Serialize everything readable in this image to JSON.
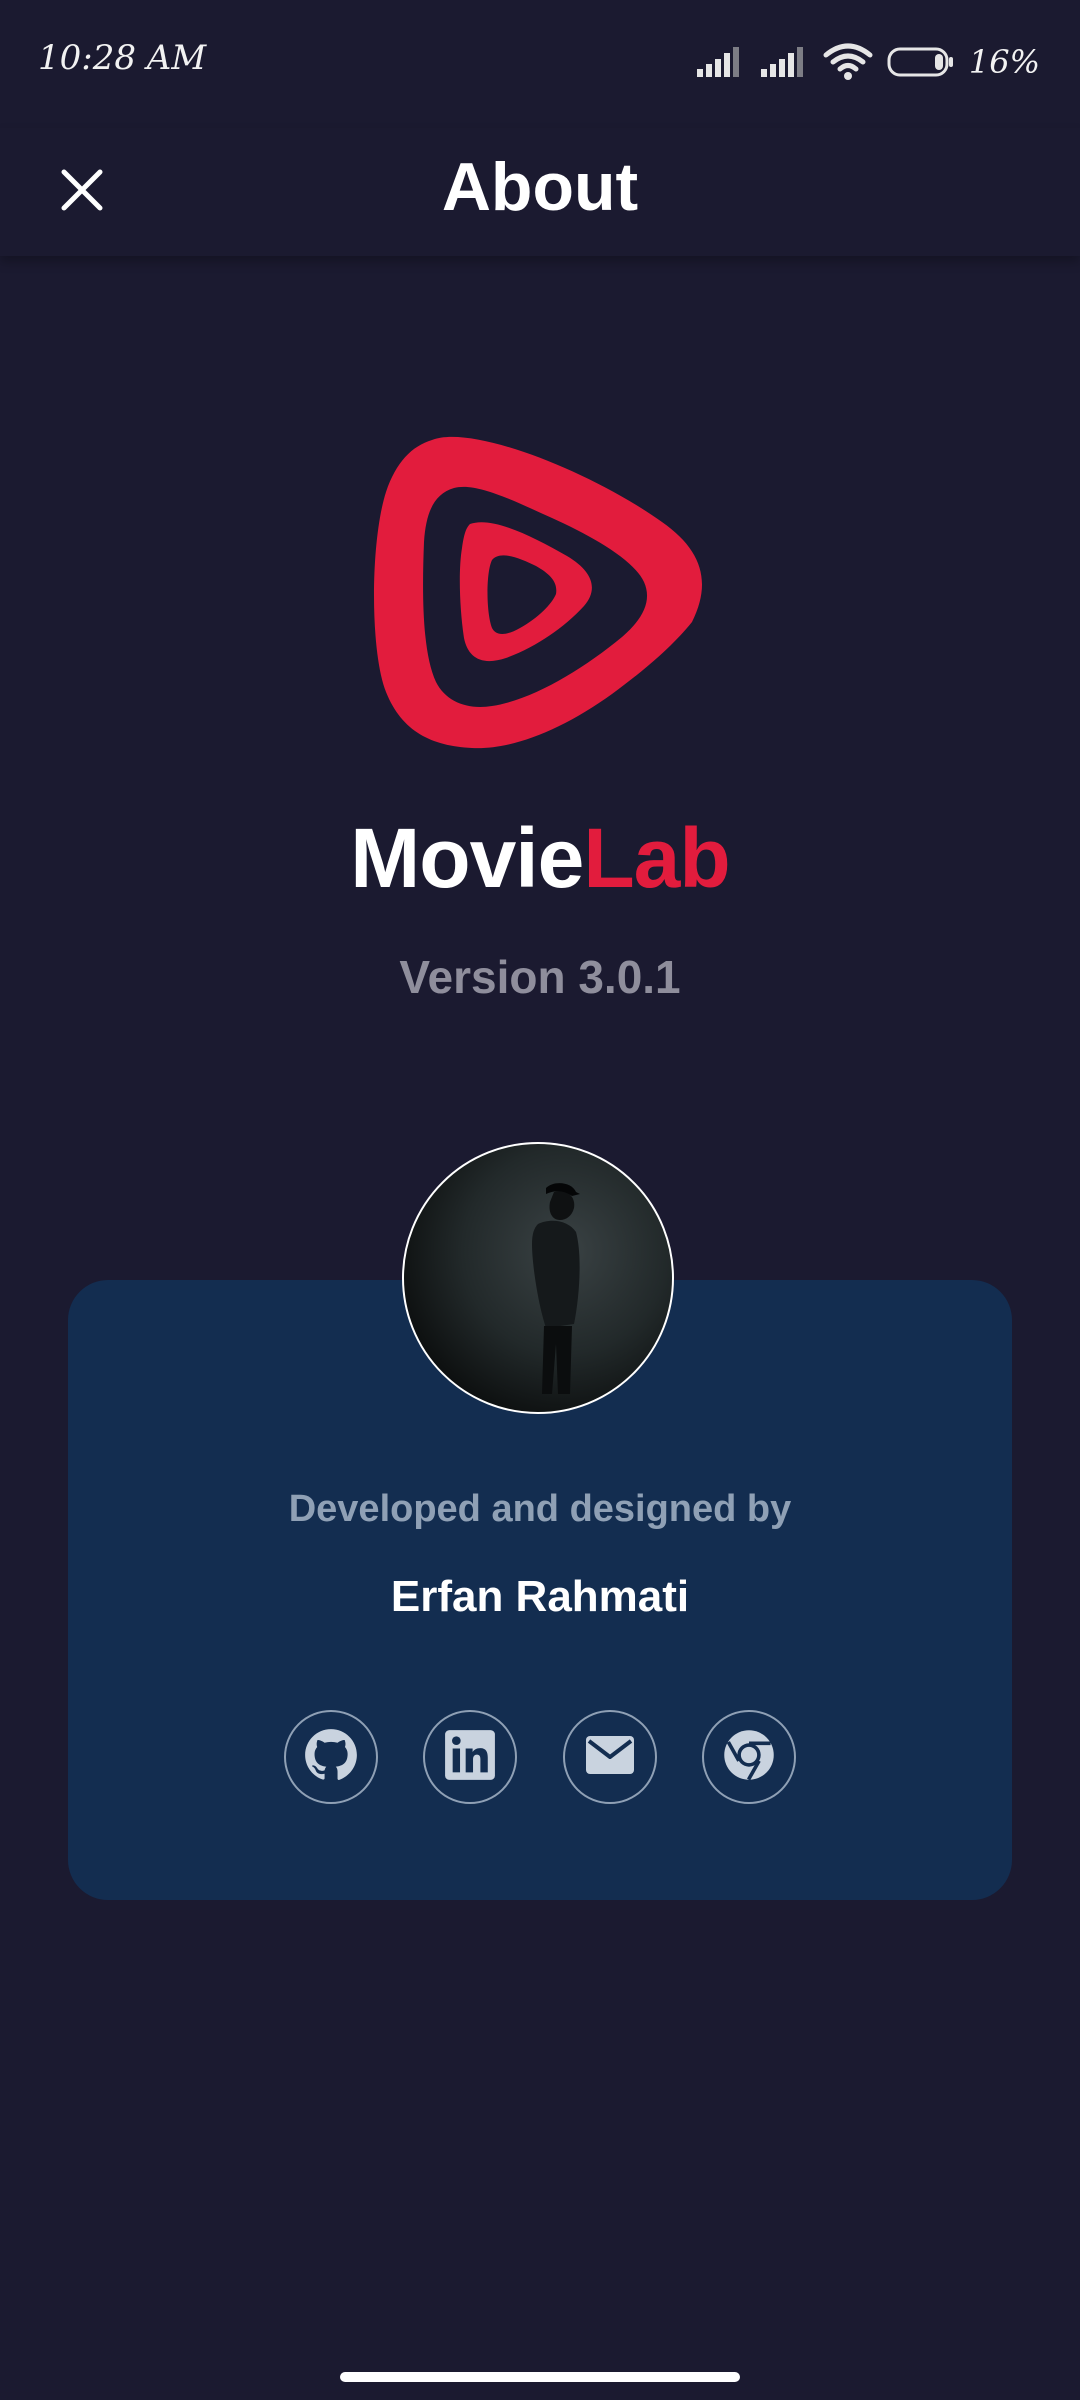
{
  "status_bar": {
    "time": "10:28 AM",
    "battery_percent": "16%",
    "icons": [
      "signal-icon",
      "signal-icon",
      "wifi-icon",
      "battery-icon"
    ]
  },
  "app_bar": {
    "title": "About",
    "close_icon": "close-icon"
  },
  "brand": {
    "logo_icon": "movielab-logo-icon",
    "name_part_a": "Movie",
    "name_part_b": "Lab",
    "version": "Version 3.0.1"
  },
  "developer": {
    "caption": "Developed and designed by",
    "name": "Erfan Rahmati",
    "social_links": [
      {
        "icon": "github-icon"
      },
      {
        "icon": "linkedin-icon"
      },
      {
        "icon": "email-icon"
      },
      {
        "icon": "chrome-icon"
      }
    ]
  },
  "colors": {
    "background": "#1b1a30",
    "card": "#132d50",
    "accent": "#e21c3d",
    "muted_text": "#8f8e9c",
    "card_muted_text": "#8fa0b5"
  }
}
